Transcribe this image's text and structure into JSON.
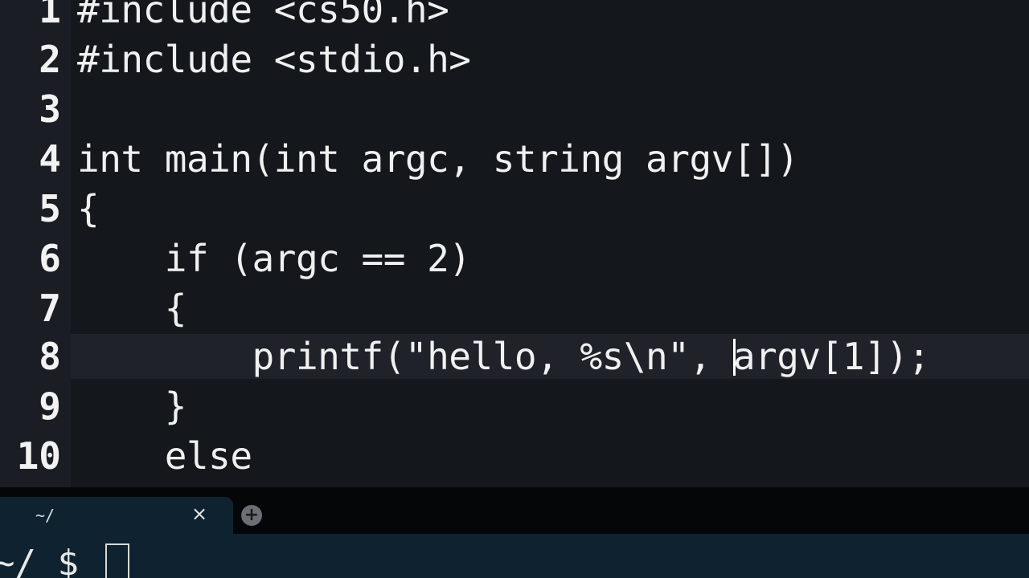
{
  "editor": {
    "lines": [
      {
        "number": "1",
        "code": "#include <cs50.h>"
      },
      {
        "number": "2",
        "code": "#include <stdio.h>"
      },
      {
        "number": "3",
        "code": ""
      },
      {
        "number": "4",
        "code": "int main(int argc, string argv[])"
      },
      {
        "number": "5",
        "code": "{"
      },
      {
        "number": "6",
        "code": "    if (argc == 2)"
      },
      {
        "number": "7",
        "code": "    {"
      },
      {
        "number": "8",
        "code_before_cursor": "        printf(\"hello, %s\\n\", ",
        "code_after_cursor": "argv[1]);"
      },
      {
        "number": "9",
        "code": "    }"
      },
      {
        "number": "10",
        "code": "    else"
      }
    ]
  },
  "terminal": {
    "tab": {
      "title": "~/",
      "close_icon": "×"
    },
    "new_tab_icon": "+",
    "prompt": "~/ $ "
  }
}
